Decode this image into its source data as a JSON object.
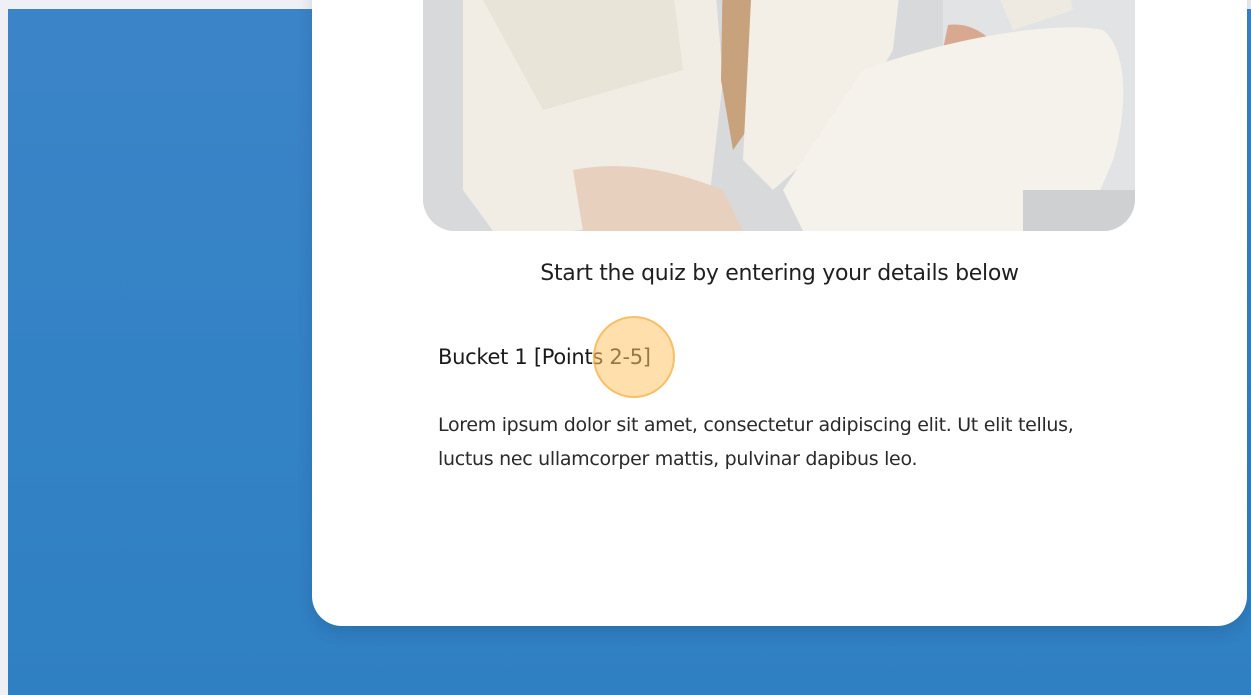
{
  "quiz": {
    "subtitle": "Start the quiz by entering your details below",
    "bucket_title": "Bucket 1 [Points 2-5]",
    "bucket_text": "Lorem ipsum dolor sit amet, consectetur adipiscing elit. Ut elit tellus, luctus nec ullamcorper mattis, pulvinar dapibus leo."
  },
  "colors": {
    "background_blue": "#3382c6",
    "card": "#ffffff",
    "cursor_highlight": "#ffc466"
  }
}
